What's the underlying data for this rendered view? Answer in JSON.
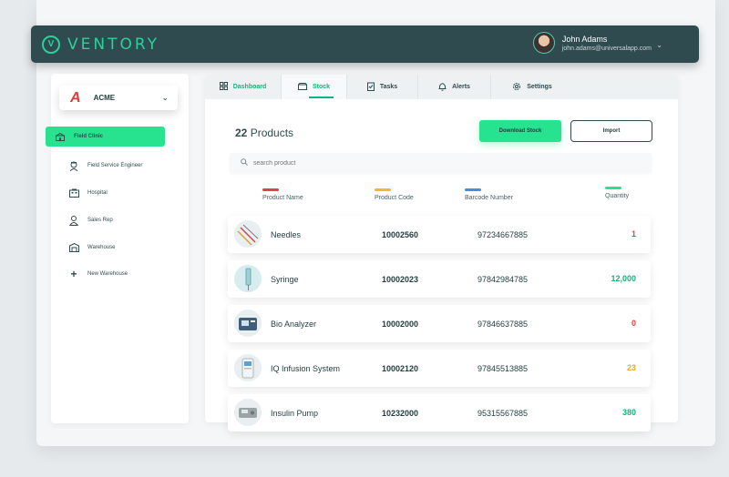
{
  "app": {
    "title": "VENTORY",
    "logo_letter": "V"
  },
  "user": {
    "name": "John Adams",
    "email": "john.adams@universalapp.com"
  },
  "company": {
    "name": "ACME",
    "logo_letter": "A"
  },
  "sidebar": {
    "items": [
      {
        "label": "Field Clinic",
        "icon": "clinic-icon"
      },
      {
        "label": "Field Service Engineer",
        "icon": "engineer-icon"
      },
      {
        "label": "Hospital",
        "icon": "hospital-icon"
      },
      {
        "label": "Sales Rep",
        "icon": "person-icon"
      },
      {
        "label": "Warehouse",
        "icon": "warehouse-icon"
      },
      {
        "label": "New Warehouse",
        "icon": "plus-icon"
      }
    ]
  },
  "tabs": [
    {
      "label": "Dashboard",
      "icon": "dashboard-icon"
    },
    {
      "label": "Stock",
      "icon": "stock-icon"
    },
    {
      "label": "Tasks",
      "icon": "tasks-icon"
    },
    {
      "label": "Alerts",
      "icon": "alerts-icon"
    },
    {
      "label": "Settings",
      "icon": "settings-icon"
    }
  ],
  "products": {
    "count": "22",
    "count_label": "Products",
    "download_label": "Download Stock",
    "import_label": "Import",
    "search_placeholder": "search product"
  },
  "columns": [
    {
      "label": "Product Name",
      "color": "#e0404a"
    },
    {
      "label": "Product Code",
      "color": "#f0b92e"
    },
    {
      "label": "Barcode Number",
      "color": "#3d8fe6"
    },
    {
      "label": "Quantity",
      "color": "#27e38f"
    }
  ],
  "rows": [
    {
      "name": "Needles",
      "code": "10002560",
      "barcode": "97234667885",
      "qty": "1",
      "qty_color": "#e0404a"
    },
    {
      "name": "Syringe",
      "code": "10002023",
      "barcode": "97842984785",
      "qty": "12,000",
      "qty_color": "#13b57a"
    },
    {
      "name": "Bio Analyzer",
      "code": "10002000",
      "barcode": "97846637885",
      "qty": "0",
      "qty_color": "#e0404a"
    },
    {
      "name": "IQ Infusion System",
      "code": "10002120",
      "barcode": "97845513885",
      "qty": "23",
      "qty_color": "#e8a92a"
    },
    {
      "name": "Insulin Pump",
      "code": "10232000",
      "barcode": "95315567885",
      "qty": "380",
      "qty_color": "#13b57a"
    }
  ],
  "colors": {
    "accent": "#27e38f",
    "header": "#2f4b4f"
  }
}
